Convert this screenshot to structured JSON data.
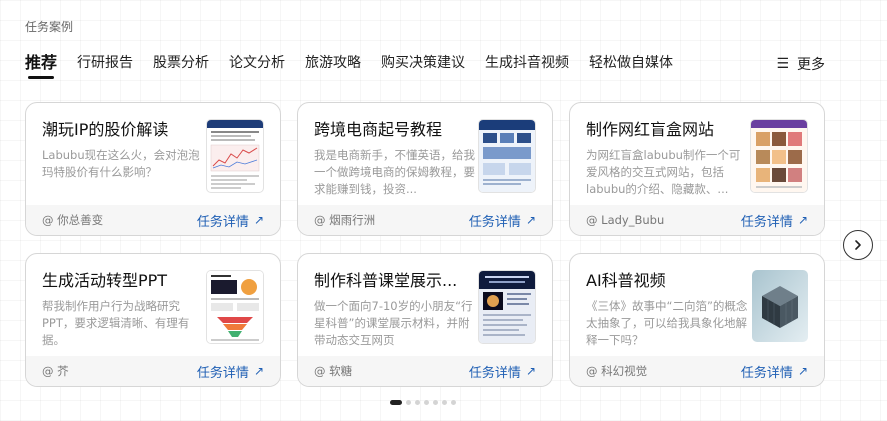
{
  "section": {
    "label": "任务案例"
  },
  "tabs": [
    {
      "label": "推荐",
      "active": true
    },
    {
      "label": "行研报告"
    },
    {
      "label": "股票分析"
    },
    {
      "label": "论文分析"
    },
    {
      "label": "旅游攻略"
    },
    {
      "label": "购买决策建议"
    },
    {
      "label": "生成抖音视频"
    },
    {
      "label": "轻松做自媒体"
    }
  ],
  "more": {
    "icon": "menu-icon",
    "label": "更多"
  },
  "cards": [
    {
      "title": "潮玩IP的股价解读",
      "desc": "Labubu现在这么火，会对泡泡玛特股价有什么影响？",
      "author": "@ 你总善变",
      "detail_label": "任务详情",
      "thumb": "stock-report-thumbnail"
    },
    {
      "title": "跨境电商起号教程",
      "desc": "我是电商新手，不懂英语，给我一个做跨境电商的保姆教程，要求能赚到钱，投资...",
      "author": "@ 烟雨行洲",
      "detail_label": "任务详情",
      "thumb": "ecommerce-guide-thumbnail"
    },
    {
      "title": "制作网红盲盒网站",
      "desc": "为网红盲盒labubu制作一个可爱风格的交互式网站，包括labubu的介绍、隐藏款、...",
      "author": "@ Lady_Bubu",
      "detail_label": "任务详情",
      "thumb": "labubu-website-thumbnail"
    },
    {
      "title": "生成活动转型PPT",
      "desc": "帮我制作用户行为战略研究PPT，要求逻辑清晰、有理有据。",
      "author": "@ 芥",
      "detail_label": "任务详情",
      "thumb": "ppt-slide-thumbnail"
    },
    {
      "title": "制作科普课堂展示...",
      "desc": "做一个面向7-10岁的小朋友“行星科普”的课堂展示材料，并附带动态交互网页",
      "author": "@ 软糖",
      "detail_label": "任务详情",
      "thumb": "planet-lesson-thumbnail"
    },
    {
      "title": "AI科普视频",
      "desc": "《三体》故事中“二向箔”的概念太抽象了，可以给我具象化地解释一下吗？",
      "author": "@ 科幻视觉",
      "detail_label": "任务详情",
      "thumb": "cube-render-thumbnail"
    }
  ],
  "pagination": {
    "total": 7,
    "active_index": 0
  },
  "colors": {
    "link": "#1f5fb4",
    "active_tab_underline": "#111111",
    "card_border": "#d6d6d6",
    "card_footer": "#f6f6f6"
  }
}
